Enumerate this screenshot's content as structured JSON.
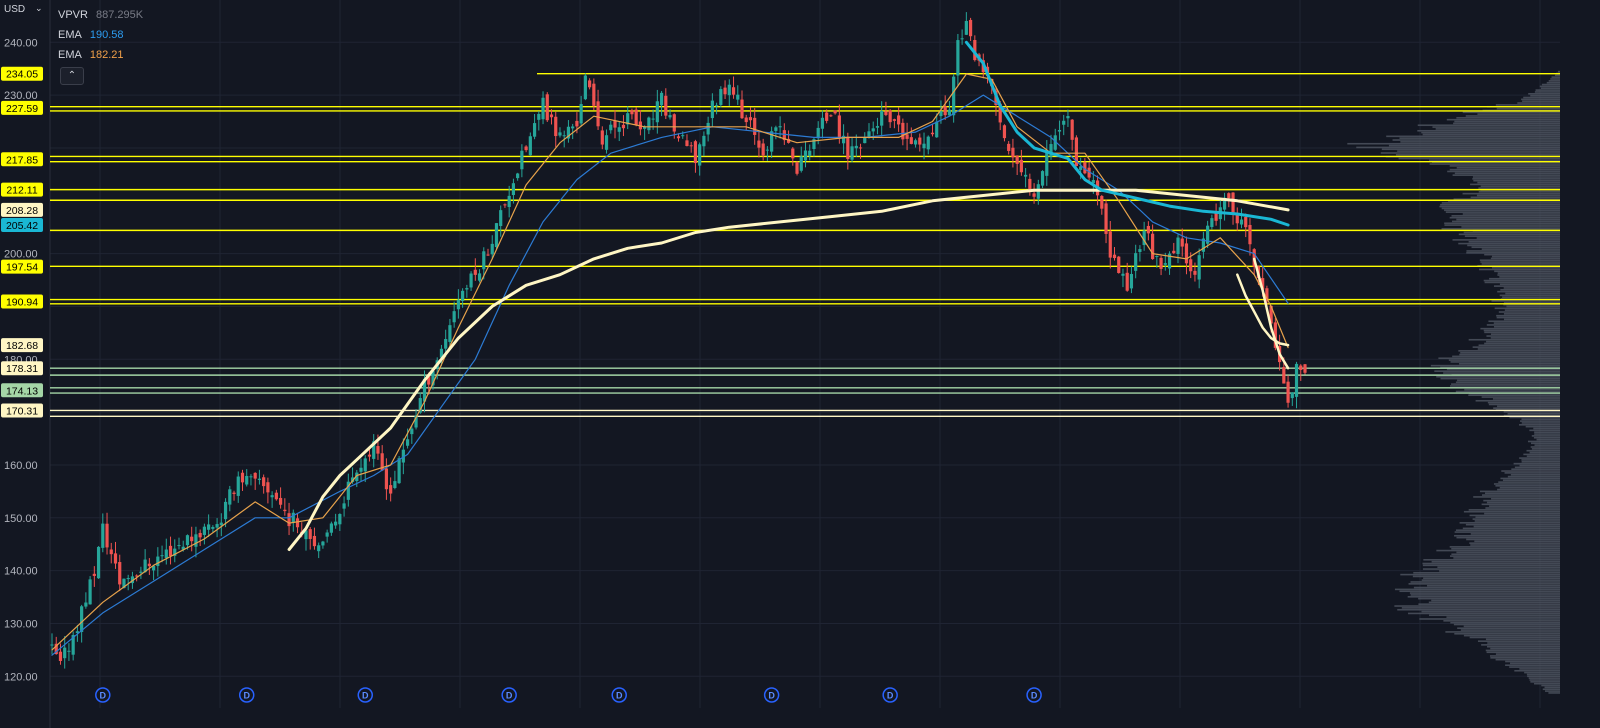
{
  "app": {
    "currency": "USD",
    "colors": {
      "background": "#131722",
      "grid": "#1f2433",
      "axis_text": "#b2b5be",
      "up_candle": "#26a69a",
      "down_candle": "#ef5350",
      "level_line": "#ffff00",
      "sma200": "#fff6c4",
      "ema_cyan": "#1ab7d4",
      "ema_blue": "#2c7bd4",
      "ema_orange": "#e8a34c",
      "volume_profile": "#4c525e"
    }
  },
  "legend": [
    {
      "name": "VPVR",
      "value": "887.295K",
      "color": "gray"
    },
    {
      "name": "EMA",
      "value": "190.58",
      "color": "blue"
    },
    {
      "name": "EMA",
      "value": "182.21",
      "color": "orange"
    }
  ],
  "collapse_icon": "chevron-up-icon",
  "chart_data": {
    "type": "candlestick",
    "y_axis": {
      "ylim": [
        114,
        248
      ],
      "ticks": [
        {
          "value": 240,
          "label": "240.00"
        },
        {
          "value": 230,
          "label": "230.00"
        },
        {
          "value": 200,
          "label": "200.00"
        },
        {
          "value": 180,
          "label": "180.00"
        },
        {
          "value": 160,
          "label": "160.00"
        },
        {
          "value": 150,
          "label": "150.00"
        },
        {
          "value": 140,
          "label": "140.00"
        },
        {
          "value": 130,
          "label": "130.00"
        },
        {
          "value": 120,
          "label": "120.00"
        }
      ]
    },
    "price_labels": [
      {
        "value": 234.05,
        "label": "234.05",
        "bg": "#ffff00",
        "fg": "#000000"
      },
      {
        "value": 227.59,
        "label": "227.59",
        "bg": "#ffff00",
        "fg": "#000000"
      },
      {
        "value": 217.85,
        "label": "217.85",
        "bg": "#ffff00",
        "fg": "#000000"
      },
      {
        "value": 212.11,
        "label": "212.11",
        "bg": "#ffff00",
        "fg": "#000000"
      },
      {
        "value": 208.28,
        "label": "208.28",
        "bg": "#fff6c4",
        "fg": "#000000"
      },
      {
        "value": 205.42,
        "label": "205.42",
        "bg": "#1ab7d4",
        "fg": "#000000"
      },
      {
        "value": 197.54,
        "label": "197.54",
        "bg": "#ffff00",
        "fg": "#000000"
      },
      {
        "value": 190.94,
        "label": "190.94",
        "bg": "#ffff00",
        "fg": "#000000"
      },
      {
        "value": 182.68,
        "label": "182.68",
        "bg": "#fff6c4",
        "fg": "#000000"
      },
      {
        "value": 178.31,
        "label": "178.31",
        "bg": "#fff6c4",
        "fg": "#000000"
      },
      {
        "value": 174.13,
        "label": "174.13",
        "bg": "#a5d6a7",
        "fg": "#000000"
      },
      {
        "value": 170.31,
        "label": "170.31",
        "bg": "#fff6c4",
        "fg": "#000000"
      }
    ],
    "horizontal_levels": [
      {
        "value": 234.05,
        "color": "#ffff00",
        "start_frac": 0.31
      },
      {
        "value": 227.8,
        "color": "#ffff00",
        "start_frac": 0.0
      },
      {
        "value": 227.0,
        "color": "#ffff00",
        "start_frac": 0.0
      },
      {
        "value": 218.4,
        "color": "#ffff00",
        "start_frac": 0.0
      },
      {
        "value": 217.4,
        "color": "#ffff00",
        "start_frac": 0.0
      },
      {
        "value": 212.11,
        "color": "#ffff00",
        "start_frac": 0.0
      },
      {
        "value": 210.1,
        "color": "#ffff00",
        "start_frac": 0.0
      },
      {
        "value": 204.4,
        "color": "#ffff00",
        "start_frac": 0.0
      },
      {
        "value": 197.6,
        "color": "#ffff00",
        "start_frac": 0.0
      },
      {
        "value": 191.3,
        "color": "#ffff00",
        "start_frac": 0.0
      },
      {
        "value": 190.5,
        "color": "#ffff00",
        "start_frac": 0.0
      },
      {
        "value": 178.31,
        "color": "#a5d6a7",
        "start_frac": 0.0
      },
      {
        "value": 177.0,
        "color": "#a5d6a7",
        "start_frac": 0.0
      },
      {
        "value": 174.6,
        "color": "#a5d6a7",
        "start_frac": 0.0
      },
      {
        "value": 173.6,
        "color": "#a5d6a7",
        "start_frac": 0.0
      },
      {
        "value": 170.31,
        "color": "#fff6c4",
        "start_frac": 0.0
      },
      {
        "value": 169.2,
        "color": "#fff6c4",
        "start_frac": 0.0
      }
    ],
    "close_path": [
      [
        0,
        125
      ],
      [
        1,
        122
      ],
      [
        3,
        130
      ],
      [
        5,
        140
      ],
      [
        6,
        148
      ],
      [
        8,
        138
      ],
      [
        12,
        142
      ],
      [
        16,
        146
      ],
      [
        20,
        150
      ],
      [
        22,
        158
      ],
      [
        26,
        155
      ],
      [
        28,
        150
      ],
      [
        30,
        148
      ],
      [
        32,
        144
      ],
      [
        34,
        152
      ],
      [
        36,
        160
      ],
      [
        38,
        163
      ],
      [
        40,
        155
      ],
      [
        42,
        165
      ],
      [
        44,
        175
      ],
      [
        46,
        182
      ],
      [
        48,
        192
      ],
      [
        50,
        196
      ],
      [
        52,
        203
      ],
      [
        54,
        212
      ],
      [
        56,
        220
      ],
      [
        58,
        228
      ],
      [
        60,
        222
      ],
      [
        62,
        225
      ],
      [
        63,
        233
      ],
      [
        65,
        222
      ],
      [
        68,
        226
      ],
      [
        70,
        223
      ],
      [
        72,
        229
      ],
      [
        74,
        222
      ],
      [
        76,
        218
      ],
      [
        78,
        228
      ],
      [
        80,
        233
      ],
      [
        82,
        225
      ],
      [
        84,
        220
      ],
      [
        86,
        224
      ],
      [
        88,
        216
      ],
      [
        90,
        222
      ],
      [
        92,
        227
      ],
      [
        94,
        219
      ],
      [
        96,
        222
      ],
      [
        98,
        226
      ],
      [
        100,
        223
      ],
      [
        102,
        220
      ],
      [
        104,
        224
      ],
      [
        106,
        228
      ],
      [
        107,
        240
      ],
      [
        108,
        244
      ],
      [
        109,
        236
      ],
      [
        111,
        232
      ],
      [
        112,
        224
      ],
      [
        114,
        216
      ],
      [
        116,
        212
      ],
      [
        118,
        222
      ],
      [
        120,
        226
      ],
      [
        121,
        218
      ],
      [
        123,
        214
      ],
      [
        125,
        200
      ],
      [
        127,
        194
      ],
      [
        129,
        205
      ],
      [
        131,
        196
      ],
      [
        133,
        202
      ],
      [
        135,
        197
      ],
      [
        137,
        206
      ],
      [
        139,
        210
      ],
      [
        141,
        204
      ],
      [
        142,
        198
      ],
      [
        143,
        193
      ],
      [
        144,
        186
      ],
      [
        145,
        180
      ],
      [
        146,
        172
      ],
      [
        147,
        178
      ],
      [
        148,
        176
      ]
    ],
    "sma200": [
      [
        28,
        144
      ],
      [
        30,
        148
      ],
      [
        32,
        154
      ],
      [
        34,
        158
      ],
      [
        36,
        161
      ],
      [
        40,
        167
      ],
      [
        44,
        176
      ],
      [
        48,
        184
      ],
      [
        52,
        190
      ],
      [
        56,
        194
      ],
      [
        60,
        196
      ],
      [
        64,
        199
      ],
      [
        68,
        201
      ],
      [
        72,
        202
      ],
      [
        76,
        204
      ],
      [
        80,
        205
      ],
      [
        86,
        206
      ],
      [
        92,
        207
      ],
      [
        98,
        208
      ],
      [
        104,
        210
      ],
      [
        110,
        211
      ],
      [
        116,
        212
      ],
      [
        122,
        212
      ],
      [
        128,
        212
      ],
      [
        134,
        211
      ],
      [
        140,
        210
      ],
      [
        146,
        208.28
      ]
    ],
    "ema_cyan": [
      [
        108,
        240
      ],
      [
        110,
        236
      ],
      [
        112,
        228
      ],
      [
        114,
        223
      ],
      [
        116,
        220
      ],
      [
        118,
        219
      ],
      [
        120,
        218
      ],
      [
        122,
        214
      ],
      [
        124,
        212
      ],
      [
        128,
        210.5
      ],
      [
        132,
        209
      ],
      [
        136,
        208
      ],
      [
        140,
        207.5
      ],
      [
        144,
        206.5
      ],
      [
        146,
        205.42
      ]
    ],
    "ema_blue": [
      [
        0,
        124
      ],
      [
        6,
        132
      ],
      [
        12,
        138
      ],
      [
        18,
        144
      ],
      [
        24,
        150
      ],
      [
        28,
        150
      ],
      [
        34,
        155
      ],
      [
        38,
        158
      ],
      [
        42,
        162
      ],
      [
        46,
        171
      ],
      [
        50,
        180
      ],
      [
        54,
        194
      ],
      [
        58,
        206
      ],
      [
        62,
        214
      ],
      [
        66,
        219
      ],
      [
        72,
        222
      ],
      [
        78,
        224
      ],
      [
        84,
        223
      ],
      [
        90,
        222
      ],
      [
        96,
        222
      ],
      [
        102,
        223
      ],
      [
        106,
        226
      ],
      [
        110,
        230
      ],
      [
        114,
        226
      ],
      [
        118,
        222
      ],
      [
        122,
        216
      ],
      [
        126,
        212
      ],
      [
        130,
        206
      ],
      [
        134,
        203
      ],
      [
        138,
        202
      ],
      [
        142,
        200
      ],
      [
        146,
        190.58
      ]
    ],
    "ema_orange": [
      [
        0,
        125
      ],
      [
        6,
        134
      ],
      [
        12,
        141
      ],
      [
        18,
        146
      ],
      [
        24,
        153
      ],
      [
        28,
        149
      ],
      [
        32,
        150
      ],
      [
        36,
        158
      ],
      [
        40,
        160
      ],
      [
        44,
        172
      ],
      [
        48,
        186
      ],
      [
        52,
        199
      ],
      [
        56,
        213
      ],
      [
        60,
        221
      ],
      [
        64,
        226
      ],
      [
        70,
        224
      ],
      [
        76,
        224
      ],
      [
        82,
        224
      ],
      [
        88,
        221
      ],
      [
        94,
        222
      ],
      [
        100,
        222
      ],
      [
        104,
        225
      ],
      [
        108,
        234
      ],
      [
        111,
        233
      ],
      [
        114,
        224
      ],
      [
        118,
        219
      ],
      [
        122,
        219
      ],
      [
        126,
        210
      ],
      [
        130,
        200
      ],
      [
        134,
        199
      ],
      [
        138,
        203
      ],
      [
        142,
        196
      ],
      [
        144,
        190
      ],
      [
        146,
        182.21
      ]
    ],
    "sma_cream_short": [
      [
        140,
        196
      ],
      [
        141,
        192
      ],
      [
        142,
        189
      ],
      [
        143,
        186
      ],
      [
        144,
        184
      ],
      [
        145,
        183
      ],
      [
        146,
        182.68
      ]
    ],
    "sma_cream_short2": [
      [
        142,
        199
      ],
      [
        143,
        193
      ],
      [
        144,
        186
      ],
      [
        145,
        181
      ],
      [
        146,
        178.31
      ]
    ],
    "dividend_markers": [
      {
        "x": 6,
        "label": "D"
      },
      {
        "x": 23,
        "label": "D"
      },
      {
        "x": 37,
        "label": "D"
      },
      {
        "x": 54,
        "label": "D"
      },
      {
        "x": 67,
        "label": "D"
      },
      {
        "x": 85,
        "label": "D"
      },
      {
        "x": 99,
        "label": "D"
      },
      {
        "x": 116,
        "label": "D"
      }
    ],
    "volume_profile_profile": [
      [
        235,
        0.0
      ],
      [
        233,
        0.05
      ],
      [
        231,
        0.12
      ],
      [
        229,
        0.2
      ],
      [
        227,
        0.4
      ],
      [
        225,
        0.55
      ],
      [
        223,
        0.7
      ],
      [
        221,
        0.9
      ],
      [
        219,
        0.82
      ],
      [
        217,
        0.62
      ],
      [
        215,
        0.45
      ],
      [
        213,
        0.38
      ],
      [
        211,
        0.45
      ],
      [
        209,
        0.52
      ],
      [
        207,
        0.55
      ],
      [
        205,
        0.5
      ],
      [
        203,
        0.45
      ],
      [
        201,
        0.42
      ],
      [
        199,
        0.36
      ],
      [
        197,
        0.35
      ],
      [
        195,
        0.33
      ],
      [
        193,
        0.3
      ],
      [
        191,
        0.3
      ],
      [
        189,
        0.3
      ],
      [
        187,
        0.32
      ],
      [
        185,
        0.35
      ],
      [
        183,
        0.42
      ],
      [
        181,
        0.5
      ],
      [
        179,
        0.55
      ],
      [
        177,
        0.52
      ],
      [
        175,
        0.48
      ],
      [
        173,
        0.38
      ],
      [
        171,
        0.3
      ],
      [
        169,
        0.22
      ],
      [
        167,
        0.14
      ],
      [
        165,
        0.13
      ],
      [
        163,
        0.15
      ],
      [
        161,
        0.18
      ],
      [
        159,
        0.25
      ],
      [
        157,
        0.3
      ],
      [
        155,
        0.36
      ],
      [
        153,
        0.38
      ],
      [
        151,
        0.42
      ],
      [
        149,
        0.45
      ],
      [
        147,
        0.44
      ],
      [
        145,
        0.48
      ],
      [
        143,
        0.55
      ],
      [
        141,
        0.62
      ],
      [
        139,
        0.68
      ],
      [
        137,
        0.72
      ],
      [
        135,
        0.7
      ],
      [
        133,
        0.7
      ],
      [
        131,
        0.6
      ],
      [
        129,
        0.5
      ],
      [
        127,
        0.4
      ],
      [
        125,
        0.35
      ],
      [
        123,
        0.3
      ],
      [
        121,
        0.2
      ],
      [
        119,
        0.12
      ],
      [
        117,
        0.05
      ]
    ]
  }
}
